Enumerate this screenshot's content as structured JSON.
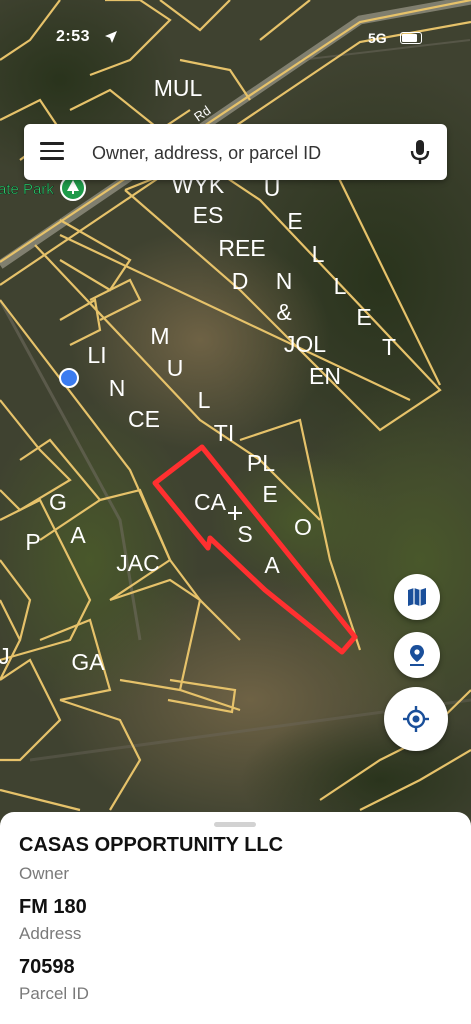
{
  "status_bar": {
    "time": "2:53",
    "network": "5G"
  },
  "search": {
    "placeholder": "Owner, address, or parcel ID"
  },
  "map": {
    "road_label": "Rd",
    "park_label": "ate Park",
    "parcel_labels": [
      "MUL",
      "WYK",
      "ES",
      "REE",
      "D",
      "U",
      "E",
      "L",
      "L",
      "E",
      "T",
      "N",
      "&",
      "JOL",
      "EN",
      "M",
      "U",
      "L",
      "TI",
      "PL",
      "E",
      "LI",
      "N",
      "CE",
      "CA",
      "S",
      "A",
      "O",
      "G",
      "A",
      "P",
      "JAC",
      "GA",
      "J"
    ],
    "colors": {
      "parcel_border": "#e6c26a",
      "selected_parcel": "#ff3030",
      "location_dot": "#3b7cf0",
      "fab_icon": "#1a4f9a"
    }
  },
  "controls": {
    "layers_icon": "map-icon",
    "pin_icon": "pin-icon",
    "locate_icon": "crosshair-icon"
  },
  "sheet": {
    "owner": "CASAS OPPORTUNITY LLC",
    "owner_label": "Owner",
    "address": "FM 180",
    "address_label": "Address",
    "parcel_id": "70598",
    "parcel_label": "Parcel ID"
  }
}
